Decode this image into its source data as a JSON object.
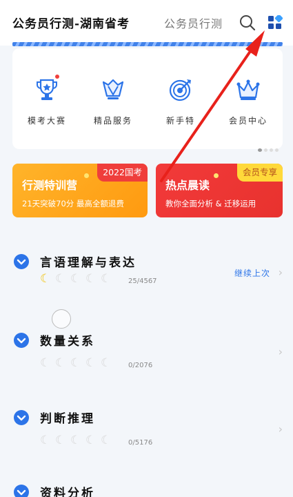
{
  "header": {
    "active_tab": "公务员行测-湖南省考",
    "inactive_tab": "公务员行测",
    "search_icon": "search-icon",
    "grid_icon": "apps-grid-icon"
  },
  "quick_links": [
    {
      "label": "模考大赛",
      "icon": "trophy-icon",
      "badge": true
    },
    {
      "label": "精品服务",
      "icon": "diamond-icon",
      "badge": false
    },
    {
      "label": "新手特",
      "icon": "target-icon",
      "badge": false
    },
    {
      "label": "会员中心",
      "icon": "crown-icon",
      "badge": false
    }
  ],
  "banners": {
    "left": {
      "title": "行测特训营",
      "tag": "2022国考",
      "subtitle": "21天突破70分 最高全额退费"
    },
    "right": {
      "title": "热点晨读",
      "tag": "会员专享",
      "subtitle": "教你全面分析 & 迁移运用"
    }
  },
  "subjects": [
    {
      "title": "言语理解与表达",
      "progress_text": "25/4567",
      "lit_moons": 1,
      "action": "继续上次"
    },
    {
      "title": "数量关系",
      "progress_text": "0/2076",
      "lit_moons": 0,
      "action": ""
    },
    {
      "title": "判断推理",
      "progress_text": "0/5176",
      "lit_moons": 0,
      "action": ""
    },
    {
      "title": "资料分析",
      "progress_text": "",
      "lit_moons": 0,
      "action": ""
    }
  ],
  "colors": {
    "accent": "#2c74e8",
    "annotation_arrow": "#e8211b",
    "banner_orange": "#ffa31a",
    "banner_red": "#ee3a36"
  }
}
